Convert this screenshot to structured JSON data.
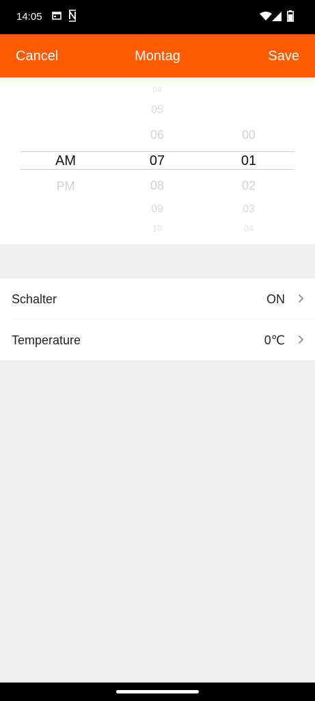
{
  "status_bar": {
    "time": "14:05",
    "icons": [
      "calendar-icon",
      "notification-n-icon",
      "wifi-icon",
      "cell-signal-icon",
      "battery-icon"
    ]
  },
  "header": {
    "cancel_label": "Cancel",
    "title": "Montag",
    "save_label": "Save",
    "background_color": "#ff5b00"
  },
  "time_picker": {
    "ampm": {
      "items": [
        "AM",
        "PM"
      ],
      "selected": "AM"
    },
    "hours": {
      "items": [
        "04",
        "05",
        "06",
        "07",
        "08",
        "09",
        "10"
      ],
      "selected": "07"
    },
    "minutes": {
      "items": [
        "00",
        "01",
        "02",
        "03",
        "04"
      ],
      "selected": "01"
    }
  },
  "settings": [
    {
      "label": "Schalter",
      "value": "ON"
    },
    {
      "label": "Temperature",
      "value": "0℃"
    }
  ]
}
